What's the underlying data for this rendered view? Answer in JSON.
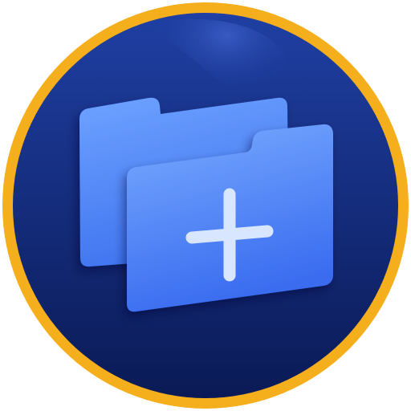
{
  "app_icon": {
    "icon_name": "add-folder-icon",
    "glyph_name": "plus-icon",
    "colors": {
      "ring": "#F5AE1C",
      "background_top": "#1F3FA3",
      "background_bottom": "#0A1A55",
      "folder_back_light": "#6EA2FF",
      "folder_back_dark": "#3F74F0",
      "folder_front_light": "#79ABFF",
      "folder_front_dark": "#3A6CF0",
      "plus": "#D9E6FF"
    }
  }
}
